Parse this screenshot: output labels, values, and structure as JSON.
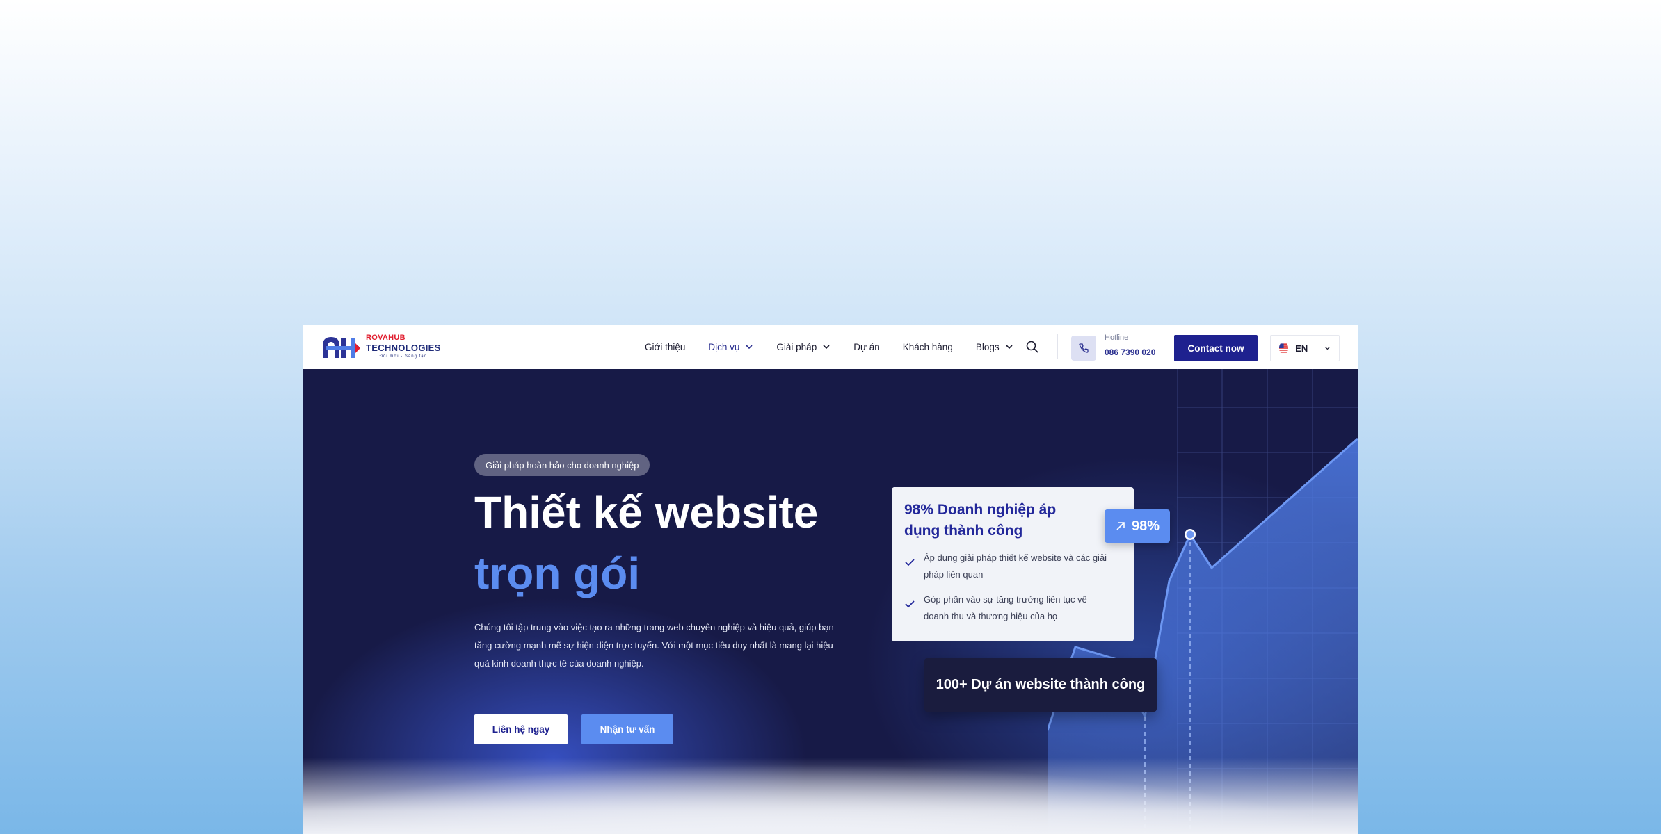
{
  "brand": {
    "line1": "ROVAHUB",
    "line2": "TECHNOLOGIES",
    "tagline": "Đổi mới - Sáng tạo"
  },
  "nav": {
    "items": [
      {
        "label": "Giới thiệu",
        "has_dropdown": false,
        "active": false
      },
      {
        "label": "Dịch vụ",
        "has_dropdown": true,
        "active": true
      },
      {
        "label": "Giải pháp",
        "has_dropdown": true,
        "active": false
      },
      {
        "label": "Dự án",
        "has_dropdown": false,
        "active": false
      },
      {
        "label": "Khách hàng",
        "has_dropdown": false,
        "active": false
      },
      {
        "label": "Blogs",
        "has_dropdown": true,
        "active": false
      }
    ],
    "hotline_label": "Hotline",
    "hotline_number": "086 7390 020",
    "contact_button": "Contact now",
    "language": "EN"
  },
  "hero": {
    "badge": "Giải pháp hoàn hảo cho doanh nghiệp",
    "title_line1": "Thiết kế website",
    "title_line2": "trọn gói",
    "description": "Chúng tôi tập trung vào việc tạo ra những trang web chuyên nghiệp và hiệu quả, giúp bạn tăng cường mạnh mẽ sự hiện diện trực tuyến. Với một mục tiêu duy nhất là mang lại hiệu quả kinh doanh thực tế của doanh nghiệp.",
    "primary_button": "Liên hệ ngay",
    "secondary_button": "Nhận tư vấn"
  },
  "stats_card": {
    "title": "98% Doanh nghiệp áp dụng thành công",
    "points": [
      "Áp dụng giải pháp thiết kế website và các giải pháp liên quan",
      "Góp phần vào sự tăng trưởng liên tục về doanh thu và thương hiệu của họ"
    ],
    "percent_badge": "98%",
    "projects_badge": "100+ Dự án website thành công"
  },
  "colors": {
    "navy": "#171a47",
    "primary": "#1e218f",
    "accent": "#5b8cf0",
    "brand_red": "#e11d2e"
  }
}
